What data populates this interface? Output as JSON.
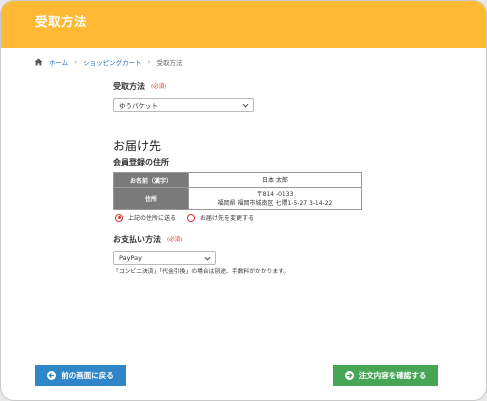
{
  "header": {
    "title": "受取方法"
  },
  "breadcrumb": {
    "items": [
      "ホーム",
      "ショッピングカート",
      "受取方法"
    ]
  },
  "receive": {
    "label": "受取方法",
    "required": "(必須)",
    "selected": "ゆうパケット"
  },
  "delivery": {
    "heading": "お届け先",
    "subheading": "会員登録の住所",
    "name_label": "お名前（漢字）",
    "name_value": "日本 太郎",
    "address_label": "住所",
    "postal": "〒814 -0133",
    "address": "福岡県 福岡市城南区 七隈1-5-27 3-14-22",
    "option_same": "上記の住所に送る",
    "option_change": "お届け先を変更する"
  },
  "payment": {
    "label": "お支払い方法",
    "required": "(必須)",
    "selected": "PayPay",
    "note": "「コンビニ決済」「代金引換」の場合は別途、手数料がかかります。"
  },
  "buttons": {
    "back": "前の画面に戻る",
    "confirm": "注文内容を確認する"
  },
  "colors": {
    "header": "#ffb935",
    "back_button": "#2f86c8",
    "confirm_button": "#47a656",
    "required": "#dd3333",
    "table_header": "#7a7a7a"
  },
  "icons": {
    "home": "home-icon",
    "chevron": "chevron-down-icon",
    "back": "arrow-left-circle-icon",
    "confirm": "arrow-right-circle-icon"
  }
}
